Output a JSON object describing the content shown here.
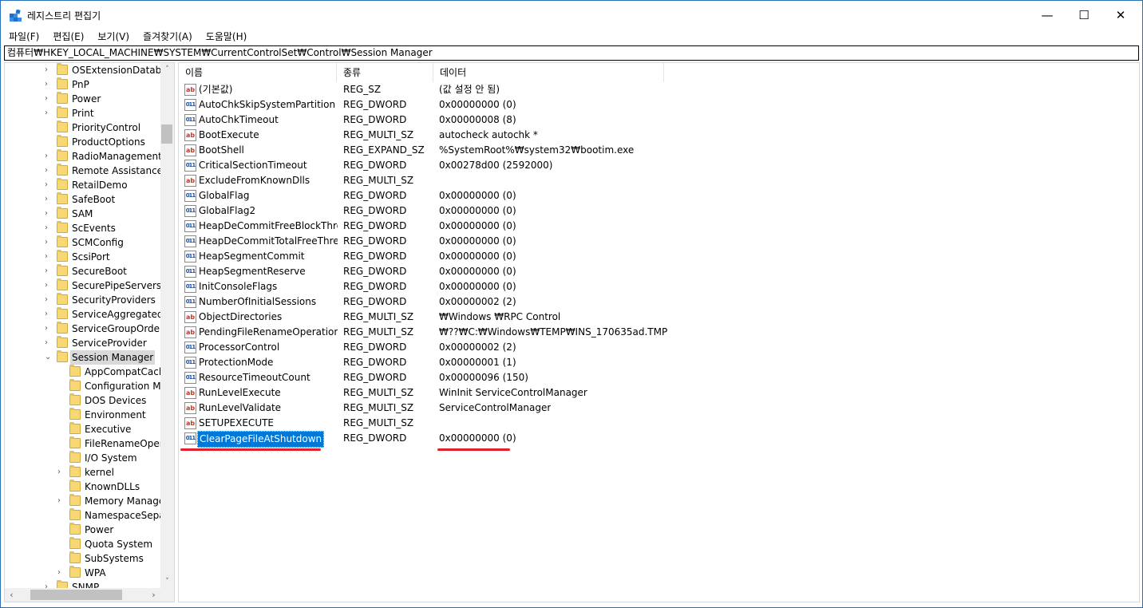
{
  "window": {
    "title": "레지스트리 편집기",
    "controls": {
      "minimize": "—",
      "maximize": "☐",
      "close": "✕"
    }
  },
  "menu": [
    "파일(F)",
    "편집(E)",
    "보기(V)",
    "즐겨찾기(A)",
    "도움말(H)"
  ],
  "address": "컴퓨터₩HKEY_LOCAL_MACHINE₩SYSTEM₩CurrentControlSet₩Control₩Session Manager",
  "tree": {
    "items": [
      {
        "label": "OSExtensionDatabase",
        "expander": "›",
        "level": 1
      },
      {
        "label": "PnP",
        "expander": "›",
        "level": 1
      },
      {
        "label": "Power",
        "expander": "›",
        "level": 1
      },
      {
        "label": "Print",
        "expander": "›",
        "level": 1
      },
      {
        "label": "PriorityControl",
        "expander": "",
        "level": 1
      },
      {
        "label": "ProductOptions",
        "expander": "",
        "level": 1
      },
      {
        "label": "RadioManagement",
        "expander": "›",
        "level": 1
      },
      {
        "label": "Remote Assistance",
        "expander": "›",
        "level": 1
      },
      {
        "label": "RetailDemo",
        "expander": "›",
        "level": 1
      },
      {
        "label": "SafeBoot",
        "expander": "›",
        "level": 1
      },
      {
        "label": "SAM",
        "expander": "›",
        "level": 1
      },
      {
        "label": "ScEvents",
        "expander": "›",
        "level": 1
      },
      {
        "label": "SCMConfig",
        "expander": "›",
        "level": 1
      },
      {
        "label": "ScsiPort",
        "expander": "›",
        "level": 1
      },
      {
        "label": "SecureBoot",
        "expander": "›",
        "level": 1
      },
      {
        "label": "SecurePipeServers",
        "expander": "›",
        "level": 1
      },
      {
        "label": "SecurityProviders",
        "expander": "›",
        "level": 1
      },
      {
        "label": "ServiceAggregatedEvents",
        "expander": "›",
        "level": 1
      },
      {
        "label": "ServiceGroupOrder",
        "expander": "›",
        "level": 1
      },
      {
        "label": "ServiceProvider",
        "expander": "›",
        "level": 1
      },
      {
        "label": "Session Manager",
        "expander": "⌄",
        "level": 1,
        "selected": true
      },
      {
        "label": "AppCompatCache",
        "expander": "",
        "level": 2
      },
      {
        "label": "Configuration Manager",
        "expander": "",
        "level": 2
      },
      {
        "label": "DOS Devices",
        "expander": "",
        "level": 2
      },
      {
        "label": "Environment",
        "expander": "",
        "level": 2
      },
      {
        "label": "Executive",
        "expander": "",
        "level": 2
      },
      {
        "label": "FileRenameOperations",
        "expander": "",
        "level": 2
      },
      {
        "label": "I/O System",
        "expander": "",
        "level": 2
      },
      {
        "label": "kernel",
        "expander": "›",
        "level": 2
      },
      {
        "label": "KnownDLLs",
        "expander": "",
        "level": 2
      },
      {
        "label": "Memory Management",
        "expander": "›",
        "level": 2
      },
      {
        "label": "NamespaceSeparation",
        "expander": "",
        "level": 2
      },
      {
        "label": "Power",
        "expander": "",
        "level": 2
      },
      {
        "label": "Quota System",
        "expander": "",
        "level": 2
      },
      {
        "label": "SubSystems",
        "expander": "",
        "level": 2
      },
      {
        "label": "WPA",
        "expander": "›",
        "level": 2
      },
      {
        "label": "SNMP",
        "expander": "›",
        "level": 1
      }
    ],
    "scroll_arrows": {
      "up": "˄",
      "down": "˅",
      "left": "‹",
      "right": "›"
    }
  },
  "list": {
    "columns": [
      "이름",
      "종류",
      "데이터"
    ],
    "rows": [
      {
        "icon": "ab",
        "kind": "sz",
        "name": "(기본값)",
        "type": "REG_SZ",
        "data": "(값 설정 안 됨)"
      },
      {
        "icon": "011",
        "kind": "dw",
        "name": "AutoChkSkipSystemPartition",
        "type": "REG_DWORD",
        "data": "0x00000000 (0)"
      },
      {
        "icon": "011",
        "kind": "dw",
        "name": "AutoChkTimeout",
        "type": "REG_DWORD",
        "data": "0x00000008 (8)"
      },
      {
        "icon": "ab",
        "kind": "sz",
        "name": "BootExecute",
        "type": "REG_MULTI_SZ",
        "data": "autocheck autochk *"
      },
      {
        "icon": "ab",
        "kind": "sz",
        "name": "BootShell",
        "type": "REG_EXPAND_SZ",
        "data": "%SystemRoot%₩system32₩bootim.exe"
      },
      {
        "icon": "011",
        "kind": "dw",
        "name": "CriticalSectionTimeout",
        "type": "REG_DWORD",
        "data": "0x00278d00 (2592000)"
      },
      {
        "icon": "ab",
        "kind": "sz",
        "name": "ExcludeFromKnownDlls",
        "type": "REG_MULTI_SZ",
        "data": ""
      },
      {
        "icon": "011",
        "kind": "dw",
        "name": "GlobalFlag",
        "type": "REG_DWORD",
        "data": "0x00000000 (0)"
      },
      {
        "icon": "011",
        "kind": "dw",
        "name": "GlobalFlag2",
        "type": "REG_DWORD",
        "data": "0x00000000 (0)"
      },
      {
        "icon": "011",
        "kind": "dw",
        "name": "HeapDeCommitFreeBlockThre...",
        "type": "REG_DWORD",
        "data": "0x00000000 (0)"
      },
      {
        "icon": "011",
        "kind": "dw",
        "name": "HeapDeCommitTotalFreeThres...",
        "type": "REG_DWORD",
        "data": "0x00000000 (0)"
      },
      {
        "icon": "011",
        "kind": "dw",
        "name": "HeapSegmentCommit",
        "type": "REG_DWORD",
        "data": "0x00000000 (0)"
      },
      {
        "icon": "011",
        "kind": "dw",
        "name": "HeapSegmentReserve",
        "type": "REG_DWORD",
        "data": "0x00000000 (0)"
      },
      {
        "icon": "011",
        "kind": "dw",
        "name": "InitConsoleFlags",
        "type": "REG_DWORD",
        "data": "0x00000000 (0)"
      },
      {
        "icon": "011",
        "kind": "dw",
        "name": "NumberOfInitialSessions",
        "type": "REG_DWORD",
        "data": "0x00000002 (2)"
      },
      {
        "icon": "ab",
        "kind": "sz",
        "name": "ObjectDirectories",
        "type": "REG_MULTI_SZ",
        "data": "₩Windows ₩RPC Control"
      },
      {
        "icon": "ab",
        "kind": "sz",
        "name": "PendingFileRenameOperations",
        "type": "REG_MULTI_SZ",
        "data": "₩??₩C:₩Windows₩TEMP₩INS_170635ad.TMP"
      },
      {
        "icon": "011",
        "kind": "dw",
        "name": "ProcessorControl",
        "type": "REG_DWORD",
        "data": "0x00000002 (2)"
      },
      {
        "icon": "011",
        "kind": "dw",
        "name": "ProtectionMode",
        "type": "REG_DWORD",
        "data": "0x00000001 (1)"
      },
      {
        "icon": "011",
        "kind": "dw",
        "name": "ResourceTimeoutCount",
        "type": "REG_DWORD",
        "data": "0x00000096 (150)"
      },
      {
        "icon": "ab",
        "kind": "sz",
        "name": "RunLevelExecute",
        "type": "REG_MULTI_SZ",
        "data": "WinInit ServiceControlManager"
      },
      {
        "icon": "ab",
        "kind": "sz",
        "name": "RunLevelValidate",
        "type": "REG_MULTI_SZ",
        "data": "ServiceControlManager"
      },
      {
        "icon": "ab",
        "kind": "sz",
        "name": "SETUPEXECUTE",
        "type": "REG_MULTI_SZ",
        "data": ""
      },
      {
        "icon": "011",
        "kind": "dw",
        "name": "ClearPageFileAtShutdown",
        "type": "REG_DWORD",
        "data": "0x00000000 (0)",
        "selected": true
      }
    ],
    "highlight_color": "#e0202b",
    "selection_color": "#0078d7"
  }
}
